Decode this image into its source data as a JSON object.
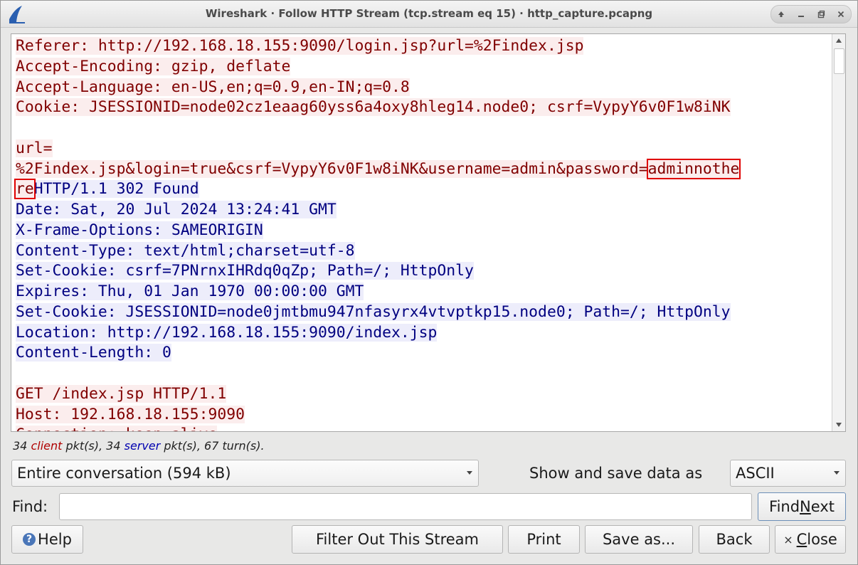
{
  "window": {
    "title": "Wireshark · Follow HTTP Stream (tcp.stream eq 15) · http_capture.pcapng"
  },
  "stream": {
    "lines": [
      [
        {
          "text": "Referer: http://192.168.18.155:9090/login.jsp?url=%2Findex.jsp",
          "dir": "client"
        }
      ],
      [
        {
          "text": "Accept-Encoding: gzip, deflate",
          "dir": "client"
        }
      ],
      [
        {
          "text": "Accept-Language: en-US,en;q=0.9,en-IN;q=0.8",
          "dir": "client"
        }
      ],
      [
        {
          "text": "Cookie: JSESSIONID=node02cz1eaag60yss6a4oxy8hleg14.node0; csrf=VypyY6v0F1w8iNK",
          "dir": "client"
        }
      ],
      [],
      [
        {
          "text": "url=",
          "dir": "client"
        }
      ],
      [
        {
          "text": "%2Findex.jsp&login=true&csrf=VypyY6v0F1w8iNK&username=admin&password=",
          "dir": "client"
        },
        {
          "text": "adminnothe",
          "dir": "client",
          "highlight": true
        }
      ],
      [
        {
          "text": "re",
          "dir": "client",
          "highlight": true
        },
        {
          "text": "HTTP/1.1 302 Found",
          "dir": "server"
        }
      ],
      [
        {
          "text": "Date: Sat, 20 Jul 2024 13:24:41 GMT",
          "dir": "server"
        }
      ],
      [
        {
          "text": "X-Frame-Options: SAMEORIGIN",
          "dir": "server"
        }
      ],
      [
        {
          "text": "Content-Type: text/html;charset=utf-8",
          "dir": "server"
        }
      ],
      [
        {
          "text": "Set-Cookie: csrf=7PNrnxIHRdq0qZp; Path=/; HttpOnly",
          "dir": "server"
        }
      ],
      [
        {
          "text": "Expires: Thu, 01 Jan 1970 00:00:00 GMT",
          "dir": "server"
        }
      ],
      [
        {
          "text": "Set-Cookie: JSESSIONID=node0jmtbmu947nfasyrx4vtvptkp15.node0; Path=/; HttpOnly",
          "dir": "server"
        }
      ],
      [
        {
          "text": "Location: http://192.168.18.155:9090/index.jsp",
          "dir": "server"
        }
      ],
      [
        {
          "text": "Content-Length: 0",
          "dir": "server"
        }
      ],
      [],
      [
        {
          "text": "GET /index.jsp HTTP/1.1",
          "dir": "client"
        }
      ],
      [
        {
          "text": "Host: 192.168.18.155:9090",
          "dir": "client"
        }
      ],
      [
        {
          "text": "Connection: keep-alive",
          "dir": "client"
        }
      ]
    ]
  },
  "stats": {
    "client_count": "34 ",
    "client_word": "client",
    "middle": " pkt(s), 34 ",
    "server_word": "server",
    "tail": " pkt(s), 67 turn(s)."
  },
  "controls": {
    "conversation_select": "Entire conversation (594 kB)",
    "show_save_label": "Show and save data as",
    "encoding_select": "ASCII",
    "find_label": "Find:",
    "find_value": "",
    "find_next_pre": "Find ",
    "find_next_u": "N",
    "find_next_post": "ext"
  },
  "buttons": {
    "help": "Help",
    "filter_out": "Filter Out This Stream",
    "print": "Print",
    "save_as": "Save as...",
    "back": "Back",
    "close_u": "C",
    "close_rest": "lose"
  }
}
